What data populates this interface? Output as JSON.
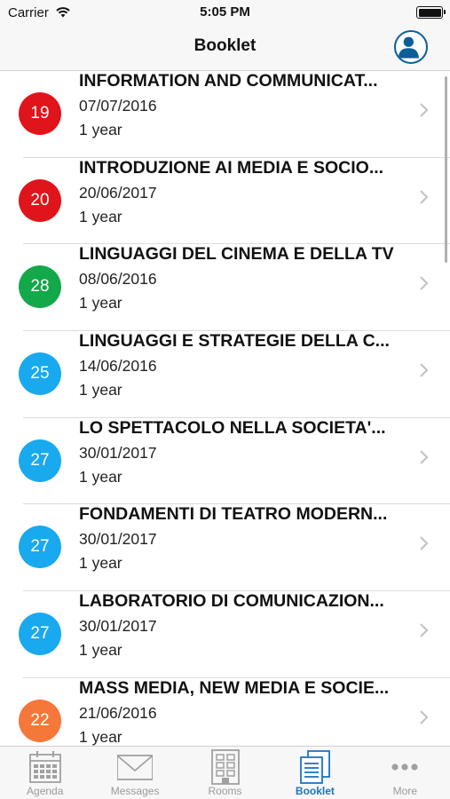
{
  "status_bar": {
    "carrier": "Carrier",
    "time": "5:05 PM"
  },
  "nav": {
    "title": "Booklet"
  },
  "courses": [
    {
      "credits": "19",
      "color": "#e0141b",
      "title": "INFORMATION AND COMMUNICAT...",
      "date": "07/07/2016",
      "duration": "1 year"
    },
    {
      "credits": "20",
      "color": "#e0141b",
      "title": "INTRODUZIONE AI MEDIA E SOCIO...",
      "date": "20/06/2017",
      "duration": "1 year"
    },
    {
      "credits": "28",
      "color": "#13a84a",
      "title": "LINGUAGGI DEL CINEMA E DELLA TV",
      "date": "08/06/2016",
      "duration": "1 year"
    },
    {
      "credits": "25",
      "color": "#19a9ee",
      "title": "LINGUAGGI E STRATEGIE DELLA C...",
      "date": "14/06/2016",
      "duration": "1 year"
    },
    {
      "credits": "27",
      "color": "#19a9ee",
      "title": "LO SPETTACOLO NELLA SOCIETA'...",
      "date": "30/01/2017",
      "duration": "1 year"
    },
    {
      "credits": "27",
      "color": "#19a9ee",
      "title": "FONDAMENTI DI TEATRO MODERN...",
      "date": "30/01/2017",
      "duration": "1 year"
    },
    {
      "credits": "27",
      "color": "#19a9ee",
      "title": "LABORATORIO DI COMUNICAZION...",
      "date": "30/01/2017",
      "duration": "1 year"
    },
    {
      "credits": "22",
      "color": "#f5773a",
      "title": "MASS MEDIA, NEW MEDIA E SOCIE...",
      "date": "21/06/2016",
      "duration": "1 year"
    }
  ],
  "tabs": [
    {
      "label": "Agenda",
      "icon": "calendar-icon"
    },
    {
      "label": "Messages",
      "icon": "envelope-icon"
    },
    {
      "label": "Rooms",
      "icon": "building-icon"
    },
    {
      "label": "Booklet",
      "icon": "booklet-icon",
      "active": true
    },
    {
      "label": "More",
      "icon": "more-dots-icon"
    }
  ],
  "colors": {
    "accent": "#1a73c8",
    "profile": "#0a5f98"
  }
}
